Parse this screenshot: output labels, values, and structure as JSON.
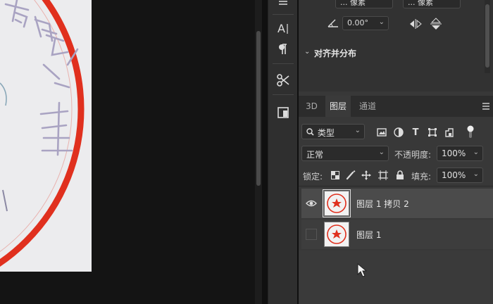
{
  "canvas": {
    "seal_text": "有限公司",
    "seal_color": "#e0301e"
  },
  "props": {
    "top_fields": [
      "... 像素",
      "... 像素"
    ],
    "angle_value": "0.00°",
    "section_title": "对齐并分布"
  },
  "layers_panel": {
    "tabs": [
      "3D",
      "图层",
      "通道"
    ],
    "active_tab": "图层",
    "filter_kind": "类型",
    "blend_mode": "正常",
    "opacity_label": "不透明度:",
    "opacity_value": "100%",
    "lock_label": "锁定:",
    "fill_label": "填充:",
    "fill_value": "100%",
    "layers": [
      {
        "name": "图层 1 拷贝 2",
        "visible": true,
        "selected": true
      },
      {
        "name": "图层 1",
        "visible": false,
        "selected": false
      }
    ]
  },
  "icons": {
    "tool_strip": [
      "panel-toggle-icon",
      "character-icon",
      "paragraph-icon",
      "tool-presets-icon",
      "properties-icon"
    ],
    "filter_icons": [
      "pixel-filter-icon",
      "adjustment-filter-icon",
      "type-filter-icon",
      "shape-filter-icon",
      "smart-object-filter-icon",
      "filter-toggle-icon"
    ],
    "lock_icons": [
      "lock-pixels-icon",
      "lock-image-icon",
      "lock-position-icon",
      "lock-artboard-icon",
      "lock-all-icon"
    ]
  }
}
